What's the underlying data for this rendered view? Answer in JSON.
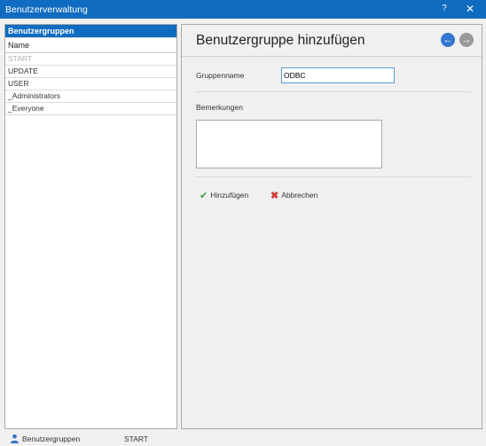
{
  "window": {
    "title": "Benutzerverwaltung",
    "help_label": "?",
    "close_label": "✕"
  },
  "left_panel": {
    "header": "Benutzergruppen",
    "column_header": "Name",
    "items": [
      {
        "label": "START",
        "dimmed": true
      },
      {
        "label": "UPDATE"
      },
      {
        "label": "USER"
      },
      {
        "label": "_Administrators"
      },
      {
        "label": "_Everyone"
      }
    ]
  },
  "form": {
    "title": "Benutzergruppe hinzufügen",
    "back_icon": "arrow-left-circle-icon",
    "forward_icon": "arrow-right-circle-icon",
    "back_glyph": "←",
    "forward_glyph": "→",
    "groupname_label": "Gruppenname",
    "groupname_value": "ODBC",
    "remarks_label": "Bemerkungen",
    "remarks_value": "",
    "add_label": "Hinzufügen",
    "cancel_label": "Abbrechen"
  },
  "statusbar": {
    "section_label": "Benutzergruppen",
    "current_item": "START"
  },
  "colors": {
    "accent": "#0f6cc0",
    "check": "#3aa04a",
    "cancel": "#d03b3b"
  }
}
